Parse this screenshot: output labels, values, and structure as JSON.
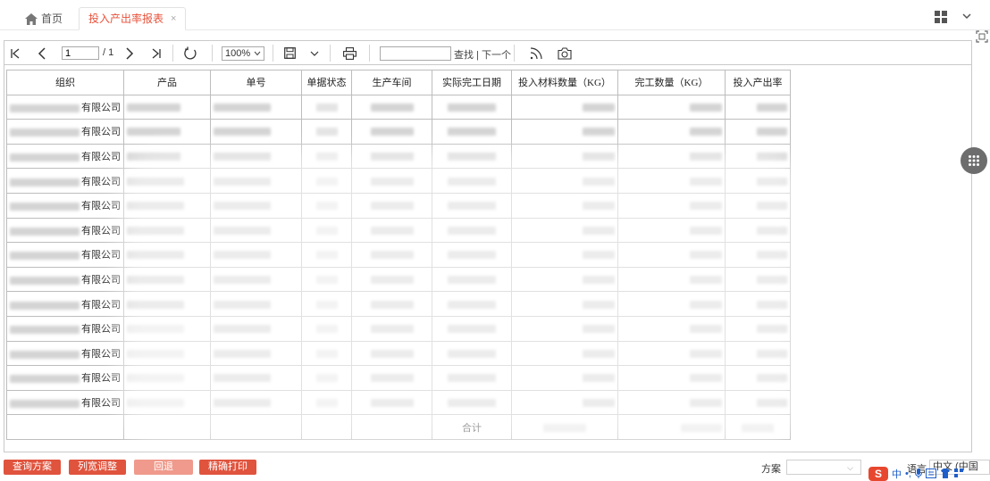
{
  "tabs": {
    "home_label": "首页",
    "active_label": "投入产出率报表",
    "close_glyph": "×"
  },
  "toolbar": {
    "page_value": "1",
    "page_total": "/ 1",
    "zoom_value": "100%",
    "find_label": "查找 | 下一个"
  },
  "table": {
    "headers": [
      "组织",
      "产品",
      "单号",
      "单据状态",
      "生产车间",
      "实际完工日期",
      "投入材料数量（KG）",
      "完工数量（KG）",
      "投入产出率"
    ],
    "row_org_suffix": "有限公司",
    "row_count": 13,
    "total_label": "合计"
  },
  "bottom": {
    "btn_query_scheme": "查询方案",
    "btn_col_width": "列宽调整",
    "btn_back": "回退",
    "btn_precise_print": "精确打印",
    "scheme_label": "方案",
    "lang_label": "语言",
    "lang_value": "中文 (中国"
  },
  "ime": {
    "logo": "S",
    "mode": "中"
  },
  "colors": {
    "accent": "#e0533d",
    "accent_disabled": "#ef9a8c",
    "border": "#bdbdbd"
  }
}
